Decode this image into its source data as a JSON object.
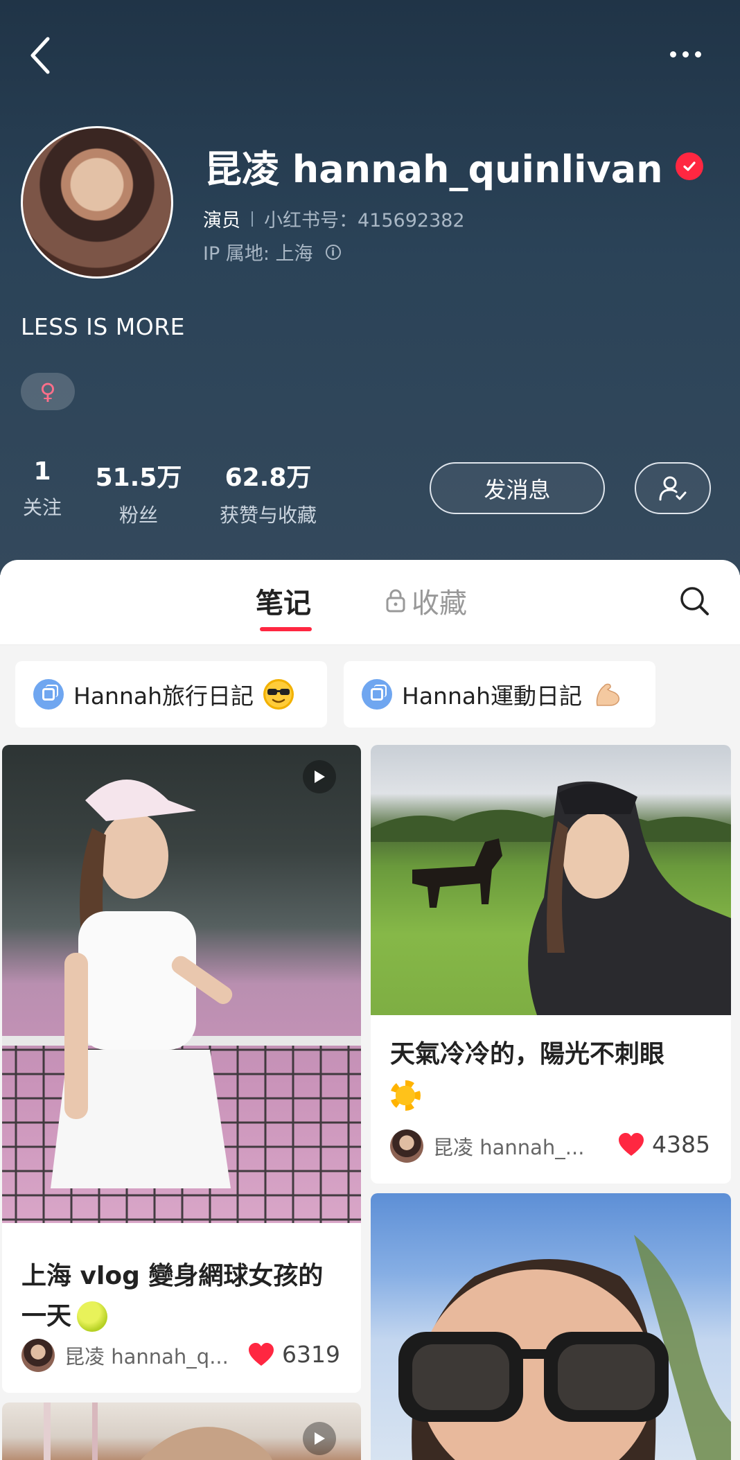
{
  "profile": {
    "name": "昆凌 hannah_quinlivan",
    "role": "演员",
    "red_id": "小红书号：415692382",
    "ip": "IP 属地: 上海",
    "bio": "LESS IS MORE",
    "gender_symbol": "♀"
  },
  "stats": [
    {
      "num": "1",
      "label": "关注"
    },
    {
      "num": "51.5万",
      "label": "粉丝"
    },
    {
      "num": "62.8万",
      "label": "获赞与收藏"
    }
  ],
  "actions": {
    "message": "发消息"
  },
  "tabs": {
    "notes": "笔记",
    "favorites": "收藏"
  },
  "collections": [
    {
      "title": "Hannah旅行日記"
    },
    {
      "title": "Hannah運動日記"
    }
  ],
  "cards": [
    {
      "title_line1": "上海 vlog 變身網球女孩的",
      "title_line2": "一天",
      "author": "昆凌 hannah_q...",
      "likes": "6319"
    },
    {
      "title_line1": "天氣冷冷的，陽光不刺眼",
      "author": "昆凌 hannah_...",
      "likes": "4385"
    }
  ],
  "colors": {
    "accent": "#ff2741",
    "header_bg": "#2b4358"
  }
}
